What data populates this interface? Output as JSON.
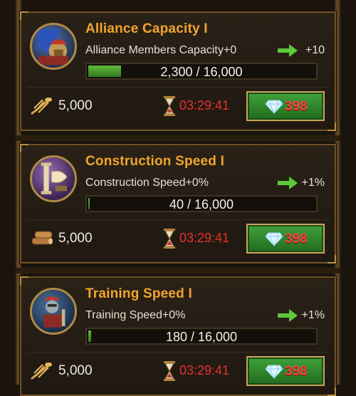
{
  "cards": [
    {
      "title": "Alliance Capacity  I",
      "description": "Alliance Members Capacity+0",
      "bonus": "+10",
      "progress_text": "2,300 / 16,000",
      "progress_fraction": 0.14375,
      "resource_icon": "wheat-icon",
      "resource_amount": "5,000",
      "timer": "03:29:41",
      "gem_cost": "398",
      "badge_icon": "warrior-banner-icon"
    },
    {
      "title": "Construction Speed  I",
      "description": "Construction Speed+0%",
      "bonus": "+1%",
      "progress_text": "40 / 16,000",
      "progress_fraction": 0.0025,
      "resource_icon": "wood-log-icon",
      "resource_amount": "5,000",
      "timer": "03:29:41",
      "gem_cost": "398",
      "badge_icon": "column-scroll-icon"
    },
    {
      "title": "Training Speed  I",
      "description": "Training Speed+0%",
      "bonus": "+1%",
      "progress_text": "180 / 16,000",
      "progress_fraction": 0.01125,
      "resource_icon": "wheat-icon",
      "resource_amount": "5,000",
      "timer": "03:29:41",
      "gem_cost": "398",
      "badge_icon": "soldier-training-icon"
    }
  ],
  "colors": {
    "title": "#f0a52a",
    "timer": "#e4332b",
    "gem_cost": "#ff4040",
    "button_green": "#3fa23a",
    "bar_fill": "#62b83a"
  }
}
